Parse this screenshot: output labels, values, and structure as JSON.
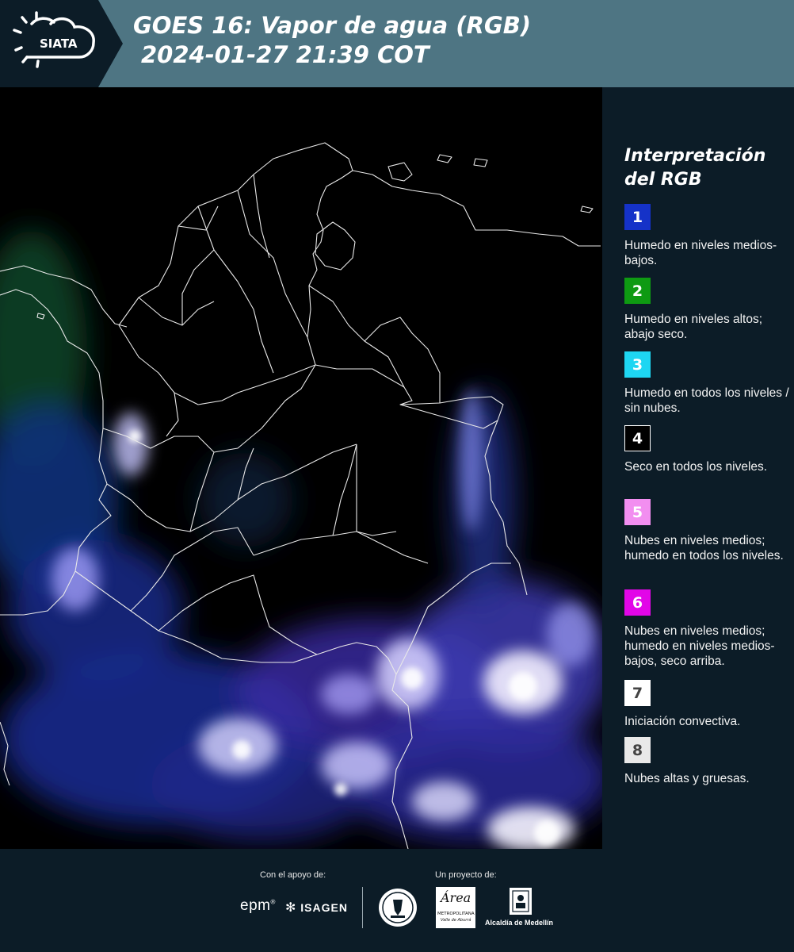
{
  "header": {
    "logo_text": "SIATA",
    "title_line1": "GOES 16: Vapor de agua (RGB)",
    "title_line2": "2024-01-27 21:39 COT"
  },
  "legend": {
    "title_line1": "Interpretación",
    "title_line2": "del RGB",
    "items": [
      {
        "number": "1",
        "color": "#1532c8",
        "text_color": "#ffffff",
        "text": "Humedo en niveles medios-bajos."
      },
      {
        "number": "2",
        "color": "#0e9a12",
        "text_color": "#ffffff",
        "text": "Humedo en niveles altos; abajo seco."
      },
      {
        "number": "3",
        "color": "#1ed6f2",
        "text_color": "#ffffff",
        "text": "Humedo en todos los niveles / sin nubes."
      },
      {
        "number": "4",
        "color": "#000000",
        "text_color": "#ffffff",
        "text": "Seco en todos los niveles."
      },
      {
        "number": "5",
        "color": "#f28ef0",
        "text_color": "#ffffff",
        "text": "Nubes en niveles medios; humedo en todos los niveles."
      },
      {
        "number": "6",
        "color": "#e206e8",
        "text_color": "#ffffff",
        "text": "Nubes en niveles medios; humedo en niveles medios-bajos, seco arriba."
      },
      {
        "number": "7",
        "color": "#ffffff",
        "text_color": "#444444",
        "text": "Iniciación convectiva."
      },
      {
        "number": "8",
        "color": "#e9e9e9",
        "text_color": "#444444",
        "text": "Nubes altas y gruesas."
      }
    ]
  },
  "footer": {
    "support_label": "Con el apoyo de:",
    "project_label": "Un proyecto de:",
    "epm": "epm",
    "isagen": "ISAGEN",
    "area_logo": "Área",
    "area_sub1": "METROPOLITANA",
    "area_sub2": "Valle de Aburrá",
    "alcaldia": "Alcaldía de Medellín"
  },
  "colors": {
    "header": "#4e7583",
    "dark_bg": "#0c1c27",
    "map_bg": "#000000"
  }
}
